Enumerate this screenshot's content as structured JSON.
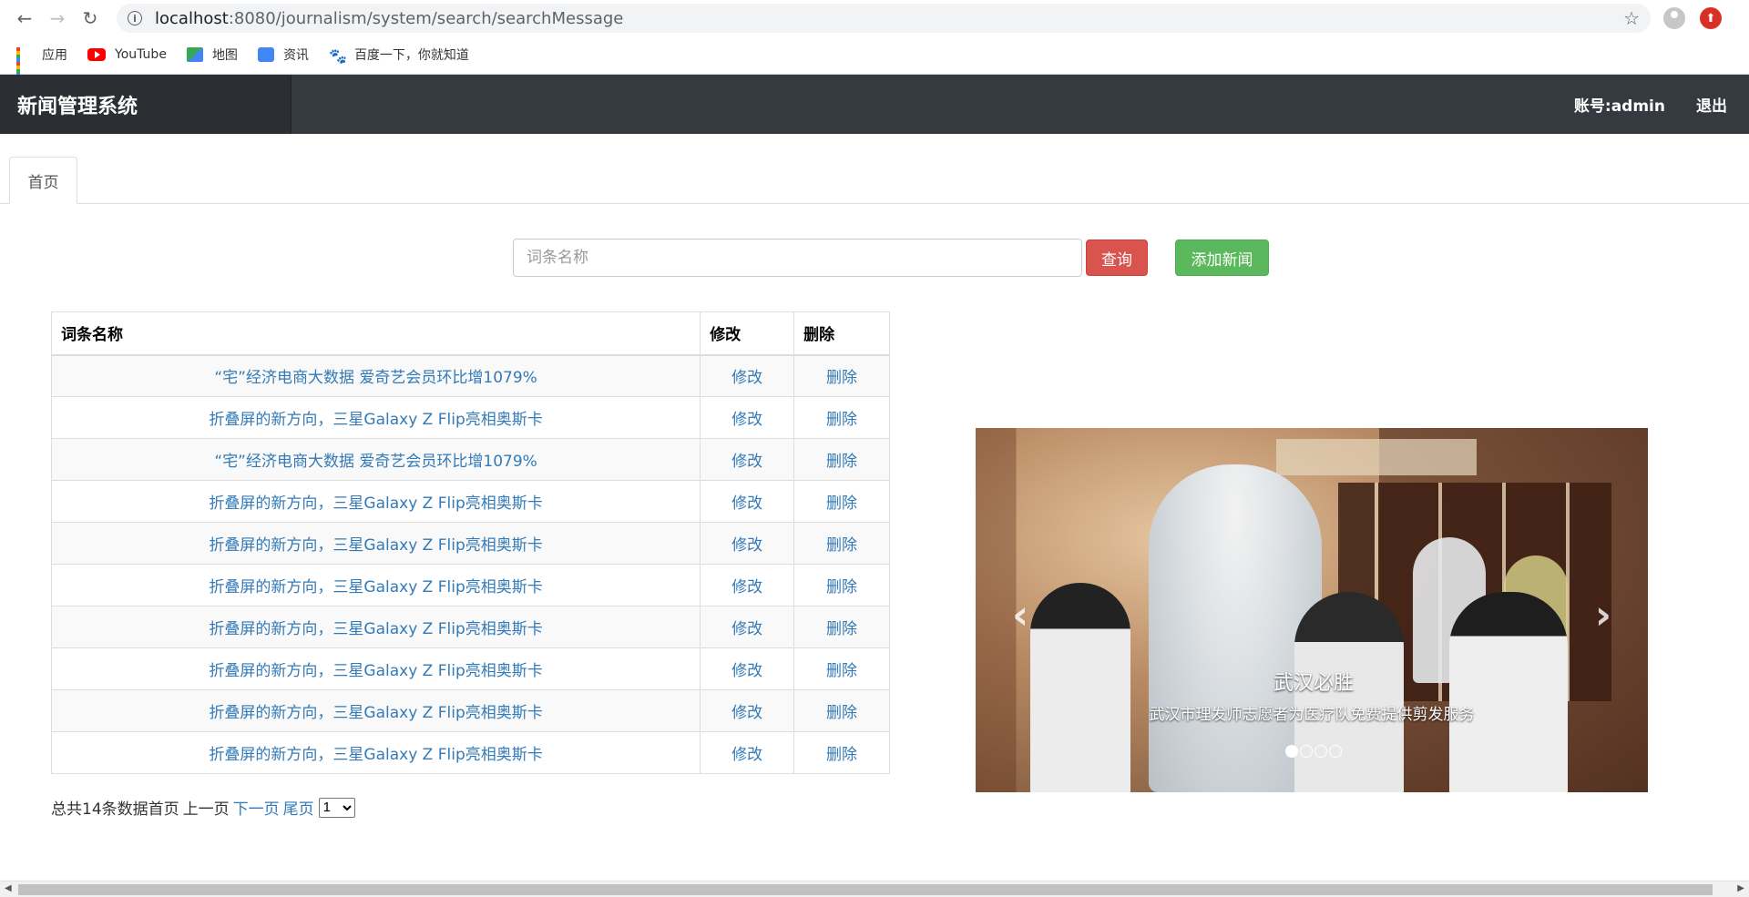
{
  "browser": {
    "url_host": "localhost",
    "url_path": ":8080/journalism/system/search/searchMessage",
    "bookmarks": [
      {
        "label": "应用",
        "icon": "apps-icon"
      },
      {
        "label": "YouTube",
        "icon": "youtube-icon"
      },
      {
        "label": "地图",
        "icon": "maps-icon"
      },
      {
        "label": "资讯",
        "icon": "news-icon"
      },
      {
        "label": "百度一下，你就知道",
        "icon": "baidu-icon"
      }
    ]
  },
  "header": {
    "brand": "新闻管理系统",
    "account": "账号:admin",
    "logout": "退出"
  },
  "tabs": [
    {
      "label": "首页"
    }
  ],
  "search": {
    "placeholder": "词条名称",
    "query_label": "查询",
    "add_label": "添加新闻"
  },
  "table": {
    "headers": [
      "词条名称",
      "修改",
      "删除"
    ],
    "rows": [
      {
        "title": "“宅”经济电商大数据 爱奇艺会员环比增1079%",
        "edit": "修改",
        "delete": "删除"
      },
      {
        "title": "折叠屏的新方向，三星Galaxy Z Flip亮相奥斯卡",
        "edit": "修改",
        "delete": "删除"
      },
      {
        "title": "“宅”经济电商大数据 爱奇艺会员环比增1079%",
        "edit": "修改",
        "delete": "删除"
      },
      {
        "title": "折叠屏的新方向，三星Galaxy Z Flip亮相奥斯卡",
        "edit": "修改",
        "delete": "删除"
      },
      {
        "title": "折叠屏的新方向，三星Galaxy Z Flip亮相奥斯卡",
        "edit": "修改",
        "delete": "删除"
      },
      {
        "title": "折叠屏的新方向，三星Galaxy Z Flip亮相奥斯卡",
        "edit": "修改",
        "delete": "删除"
      },
      {
        "title": "折叠屏的新方向，三星Galaxy Z Flip亮相奥斯卡",
        "edit": "修改",
        "delete": "删除"
      },
      {
        "title": "折叠屏的新方向，三星Galaxy Z Flip亮相奥斯卡",
        "edit": "修改",
        "delete": "删除"
      },
      {
        "title": "折叠屏的新方向，三星Galaxy Z Flip亮相奥斯卡",
        "edit": "修改",
        "delete": "删除"
      },
      {
        "title": "折叠屏的新方向，三星Galaxy Z Flip亮相奥斯卡",
        "edit": "修改",
        "delete": "删除"
      }
    ]
  },
  "pager": {
    "summary": "总共14条数据首页",
    "prev": "上一页",
    "next": "下一页",
    "last": "尾页",
    "page_selected": "1"
  },
  "carousel": {
    "caption_title": "武汉必胜",
    "caption_sub": "武汉市理发师志愿者为医疗队免费提供剪发服务",
    "slide_count": 4,
    "active_index": 0,
    "prev_arrow": "‹",
    "next_arrow": "›"
  },
  "colors": {
    "header_bg": "#343a40",
    "brand_bg": "#2b2f33",
    "link": "#337ab7",
    "query_btn": "#d9534f",
    "add_btn": "#5cb85c"
  }
}
